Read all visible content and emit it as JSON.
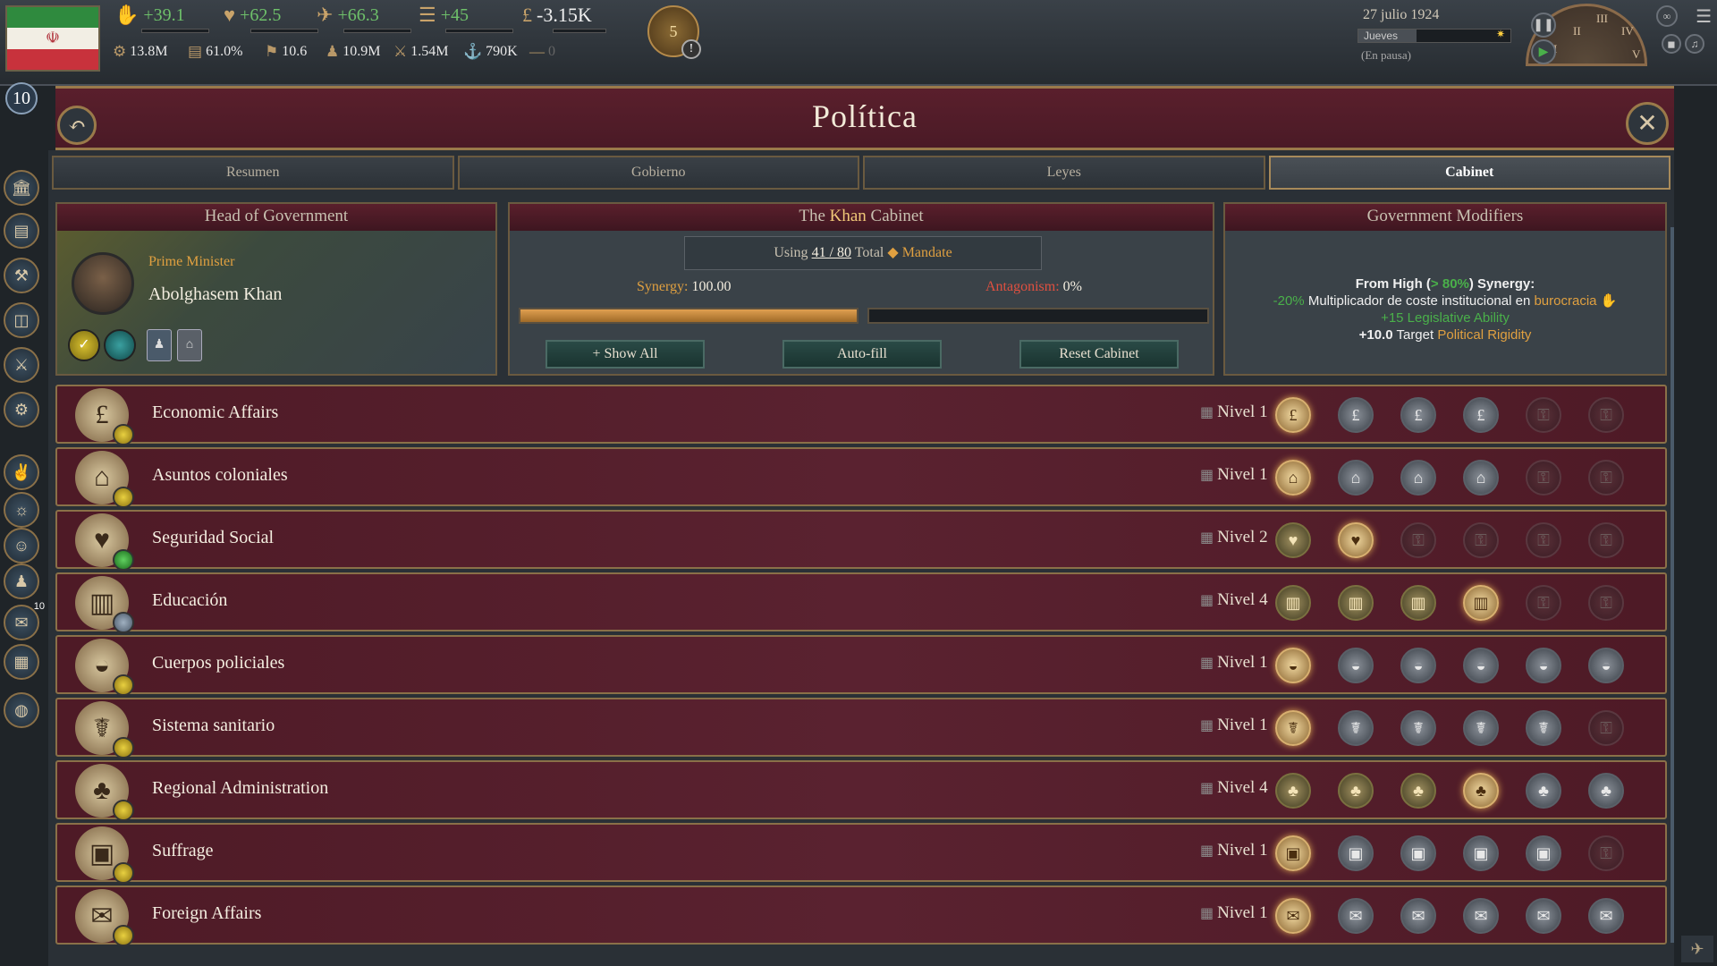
{
  "topbar": {
    "stats": [
      {
        "icon": "legitimacy-icon",
        "glyph": "✋",
        "value": "+39.1"
      },
      {
        "icon": "authority-icon",
        "glyph": "♥",
        "value": "+62.5"
      },
      {
        "icon": "influence-icon",
        "glyph": "✈",
        "value": "+66.3"
      },
      {
        "icon": "bureaucracy-icon",
        "glyph": "☰",
        "value": "+45"
      }
    ],
    "money": {
      "icon": "pound-icon",
      "glyph": "£",
      "value": "-3.15K"
    },
    "row2": [
      {
        "icon": "gdp-icon",
        "glyph": "⚙",
        "value": "13.8M"
      },
      {
        "icon": "literacy-icon",
        "glyph": "▤",
        "value": "61.0%"
      },
      {
        "icon": "prestige-icon",
        "glyph": "⚑",
        "value": "10.6"
      },
      {
        "icon": "population-icon",
        "glyph": "♟",
        "value": "10.9M"
      },
      {
        "icon": "army-icon",
        "glyph": "⚔",
        "value": "1.54M"
      },
      {
        "icon": "navy-icon",
        "glyph": "⚓",
        "value": "790K"
      },
      {
        "icon": "infamy-icon",
        "glyph": "—",
        "value": "0"
      }
    ],
    "alerts_count": "5",
    "date": "27 julio 1924",
    "weekday": "Jueves",
    "paused": "(En pausa)",
    "rank": "10",
    "clock_numerals": [
      "I",
      "II",
      "III",
      "IV",
      "V"
    ]
  },
  "header": {
    "title": "Política"
  },
  "tabs": [
    {
      "label": "Resumen",
      "active": false
    },
    {
      "label": "Gobierno",
      "active": false
    },
    {
      "label": "Leyes",
      "active": false
    },
    {
      "label": "Cabinet",
      "active": true
    }
  ],
  "head_of_government": {
    "header": "Head of Government",
    "role": "Prime Minister",
    "name": "Abolghasem Khan"
  },
  "cabinet": {
    "header_prefix": "The ",
    "header_name": "Khan",
    "header_suffix": " Cabinet",
    "using_prefix": "Using ",
    "using_value": "41 / 80",
    "using_mid": " Total ",
    "mandate_label": "Mandate",
    "synergy_label": "Synergy:",
    "synergy_value": "100.00",
    "synergy_fill": 1.0,
    "antagonism_label": "Antagonism:",
    "antagonism_value": "0%",
    "antagonism_fill": 0.0,
    "buttons": {
      "show_all": "+ Show All",
      "auto_fill": "Auto-fill",
      "reset": "Reset Cabinet"
    }
  },
  "modifiers": {
    "header": "Government Modifiers",
    "line1_prefix": "From High (",
    "line1_threshold": "> 80%",
    "line1_suffix": ") Synergy:",
    "line2_value": "-20%",
    "line2_text": " Multiplicador de coste institucional en ",
    "line2_link": "burocracia",
    "line3_value": "+15",
    "line3_text": " Legislative Ability",
    "line4_value": "+10.0",
    "line4_text": " Target ",
    "line4_link": "Political Rigidity"
  },
  "ministries": [
    {
      "name": "Economic Affairs",
      "level": "Nivel 1",
      "glyph": "£",
      "badge": "gold",
      "slots": [
        "cur",
        "off",
        "off",
        "off",
        "lock",
        "lock"
      ]
    },
    {
      "name": "Asuntos coloniales",
      "level": "Nivel 1",
      "glyph": "⌂",
      "badge": "gold",
      "slots": [
        "cur",
        "off",
        "off",
        "off",
        "lock",
        "lock"
      ]
    },
    {
      "name": "Seguridad Social",
      "level": "Nivel 2",
      "glyph": "♥",
      "badge": "green",
      "slots": [
        "on",
        "cur",
        "lock",
        "lock",
        "lock",
        "lock"
      ]
    },
    {
      "name": "Educación",
      "level": "Nivel 4",
      "glyph": "▥",
      "badge": "grey",
      "slots": [
        "on",
        "on",
        "on",
        "cur",
        "lock",
        "lock"
      ]
    },
    {
      "name": "Cuerpos policiales",
      "level": "Nivel 1",
      "glyph": "◒",
      "badge": "gold",
      "slots": [
        "cur",
        "off",
        "off",
        "off",
        "off",
        "off"
      ]
    },
    {
      "name": "Sistema sanitario",
      "level": "Nivel 1",
      "glyph": "☤",
      "badge": "gold",
      "slots": [
        "cur",
        "off",
        "off",
        "off",
        "off",
        "lock"
      ]
    },
    {
      "name": "Regional Administration",
      "level": "Nivel 4",
      "glyph": "♣",
      "badge": "gold",
      "slots": [
        "on",
        "on",
        "on",
        "cur",
        "off",
        "off"
      ]
    },
    {
      "name": "Suffrage",
      "level": "Nivel 1",
      "glyph": "▣",
      "badge": "gold",
      "slots": [
        "cur",
        "off",
        "off",
        "off",
        "off",
        "lock"
      ]
    },
    {
      "name": "Foreign Affairs",
      "level": "Nivel 1",
      "glyph": "✉",
      "badge": "gold",
      "slots": [
        "cur",
        "off",
        "off",
        "off",
        "off",
        "off"
      ]
    }
  ],
  "sidebar": [
    {
      "name": "government-icon",
      "glyph": "🏛"
    },
    {
      "name": "economy-icon",
      "glyph": "▤"
    },
    {
      "name": "industry-icon",
      "glyph": "⚒"
    },
    {
      "name": "market-icon",
      "glyph": "◫"
    },
    {
      "name": "military-icon",
      "glyph": "⚔"
    },
    {
      "name": "diplomacy-icon",
      "glyph": "⚙"
    },
    {
      "name": "peace-icon",
      "glyph": "✌"
    },
    {
      "name": "religion-icon",
      "glyph": "☼"
    },
    {
      "name": "culture-icon",
      "glyph": "☺"
    },
    {
      "name": "people-icon",
      "glyph": "♟"
    },
    {
      "name": "notifications-icon",
      "glyph": "✉",
      "badge": "10"
    },
    {
      "name": "ledger-icon",
      "glyph": "▦"
    },
    {
      "name": "world-icon",
      "glyph": "◍"
    }
  ]
}
